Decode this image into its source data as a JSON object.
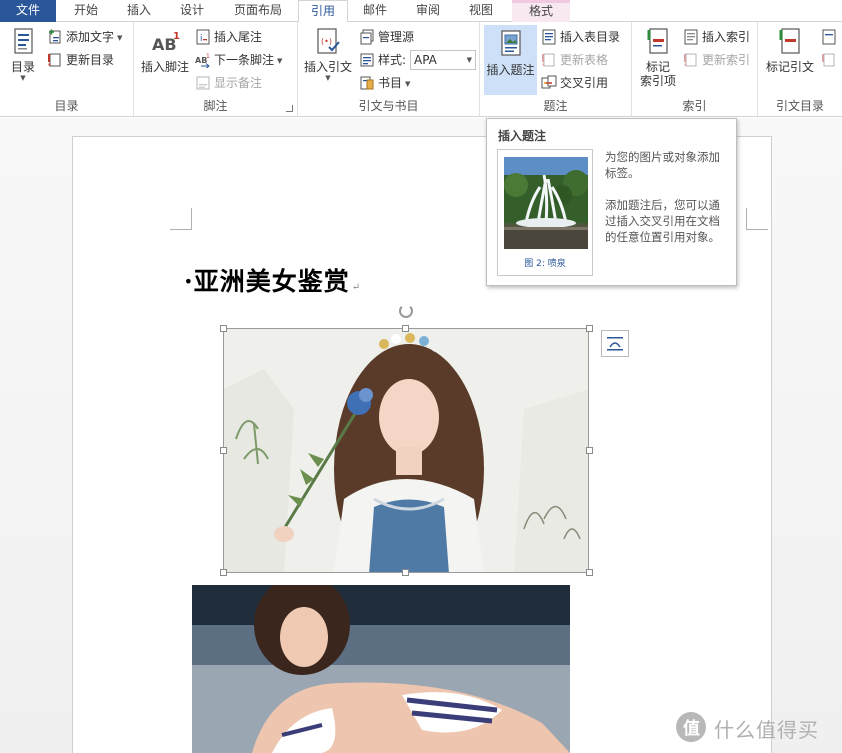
{
  "tabs": [
    {
      "label": "文件"
    },
    {
      "label": "开始"
    },
    {
      "label": "插入"
    },
    {
      "label": "设计"
    },
    {
      "label": "页面布局"
    },
    {
      "label": "引用"
    },
    {
      "label": "邮件"
    },
    {
      "label": "审阅"
    },
    {
      "label": "视图"
    },
    {
      "label": "格式"
    }
  ],
  "ribbon": {
    "toc": {
      "group_label": "目录",
      "toc_button": "目录",
      "add_text": "添加文字",
      "update_toc": "更新目录"
    },
    "footnotes": {
      "group_label": "脚注",
      "insert_footnote_line1": "插入脚注",
      "insert_endnote": "插入尾注",
      "next_footnote": "下一条脚注",
      "show_notes": "显示备注"
    },
    "citations": {
      "group_label": "引文与书目",
      "insert_citation": "插入引文",
      "manage_sources": "管理源",
      "style_label": "样式:",
      "style_value": "APA",
      "bibliography": "书目"
    },
    "captions": {
      "group_label": "题注",
      "insert_caption": "插入题注",
      "insert_table_of_figures": "插入表目录",
      "update_table": "更新表格",
      "cross_reference": "交叉引用"
    },
    "index": {
      "group_label": "索引",
      "mark_entry_line1": "标记",
      "mark_entry_line2": "索引项",
      "insert_index": "插入索引",
      "update_index": "更新索引"
    },
    "toa": {
      "group_label": "引文目录",
      "mark_citation": "标记引文"
    }
  },
  "tooltip": {
    "title": "插入题注",
    "caption_label": "图 2:",
    "caption_text": "喷泉",
    "desc1": "为您的图片或对象添加标签。",
    "desc2": "添加题注后，您可以通过插入交叉引用在文档的任意位置引用对象。"
  },
  "document": {
    "heading": "亚洲美女鉴赏",
    "pilcrow": "↵"
  },
  "colors": {
    "accent": "#2b579a",
    "selected_button": "#cde0f7",
    "context_tab": "#f7e8f2"
  },
  "watermark": {
    "text": "什么值得买"
  }
}
